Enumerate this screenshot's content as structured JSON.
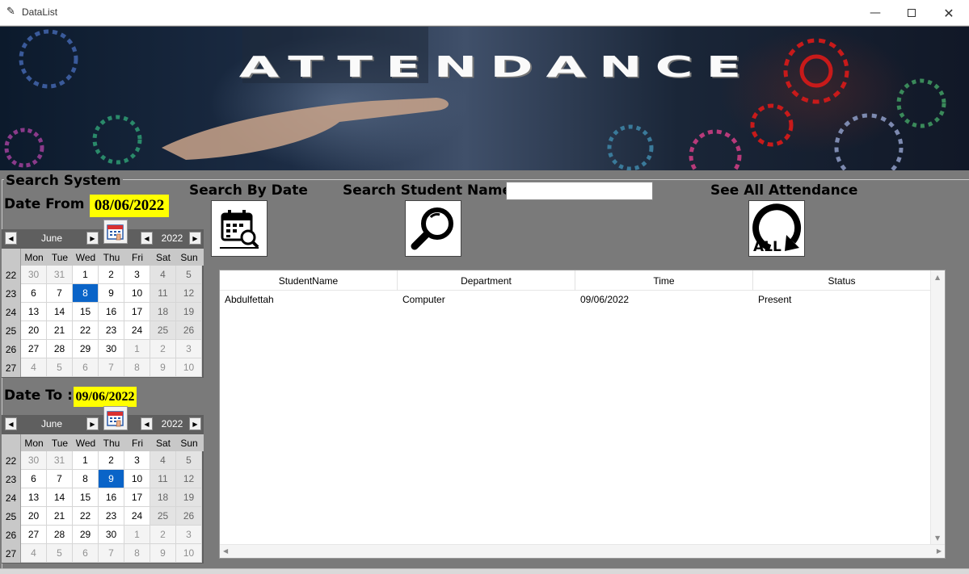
{
  "window": {
    "title": "DataList",
    "minimize": "—",
    "close": "✕",
    "app_icon": "feather-icon"
  },
  "banner": {
    "text": "ATTENDANCE"
  },
  "search": {
    "title": "Search System",
    "date_from_label": "Date From :",
    "date_from_value": "08/06/2022",
    "date_to_label": "Date To :",
    "date_to_value": "09/06/2022",
    "by_date_label": "Search By Date",
    "by_name_label": "Search Student Name:",
    "name_input_value": "",
    "see_all_label": "See All Attendance",
    "see_all_icon_text": "ALL"
  },
  "calendar_from": {
    "month": "June",
    "year": "2022",
    "day_names": [
      "Mon",
      "Tue",
      "Wed",
      "Thu",
      "Fri",
      "Sat",
      "Sun"
    ],
    "prev": "◀",
    "next": "▶",
    "selected": "8",
    "weeks": [
      {
        "wk": "22",
        "days": [
          "30",
          "31",
          "1",
          "2",
          "3",
          "4",
          "5"
        ]
      },
      {
        "wk": "23",
        "days": [
          "6",
          "7",
          "8",
          "9",
          "10",
          "11",
          "12"
        ]
      },
      {
        "wk": "24",
        "days": [
          "13",
          "14",
          "15",
          "16",
          "17",
          "18",
          "19"
        ]
      },
      {
        "wk": "25",
        "days": [
          "20",
          "21",
          "22",
          "23",
          "24",
          "25",
          "26"
        ]
      },
      {
        "wk": "26",
        "days": [
          "27",
          "28",
          "29",
          "30",
          "1",
          "2",
          "3"
        ]
      },
      {
        "wk": "27",
        "days": [
          "4",
          "5",
          "6",
          "7",
          "8",
          "9",
          "10"
        ]
      }
    ]
  },
  "calendar_to": {
    "month": "June",
    "year": "2022",
    "day_names": [
      "Mon",
      "Tue",
      "Wed",
      "Thu",
      "Fri",
      "Sat",
      "Sun"
    ],
    "prev": "◀",
    "next": "▶",
    "selected": "9",
    "weeks": [
      {
        "wk": "22",
        "days": [
          "30",
          "31",
          "1",
          "2",
          "3",
          "4",
          "5"
        ]
      },
      {
        "wk": "23",
        "days": [
          "6",
          "7",
          "8",
          "9",
          "10",
          "11",
          "12"
        ]
      },
      {
        "wk": "24",
        "days": [
          "13",
          "14",
          "15",
          "16",
          "17",
          "18",
          "19"
        ]
      },
      {
        "wk": "25",
        "days": [
          "20",
          "21",
          "22",
          "23",
          "24",
          "25",
          "26"
        ]
      },
      {
        "wk": "26",
        "days": [
          "27",
          "28",
          "29",
          "30",
          "1",
          "2",
          "3"
        ]
      },
      {
        "wk": "27",
        "days": [
          "4",
          "5",
          "6",
          "7",
          "8",
          "9",
          "10"
        ]
      }
    ]
  },
  "table": {
    "columns": [
      "StudentName",
      "Department",
      "Time",
      "Status"
    ],
    "rows": [
      [
        "Abdulfettah",
        "Computer",
        "09/06/2022",
        "Present"
      ]
    ]
  },
  "colors": {
    "background": "#7a7a7a",
    "date_highlight": "#ffff00",
    "selected_day": "#0a64c8"
  }
}
